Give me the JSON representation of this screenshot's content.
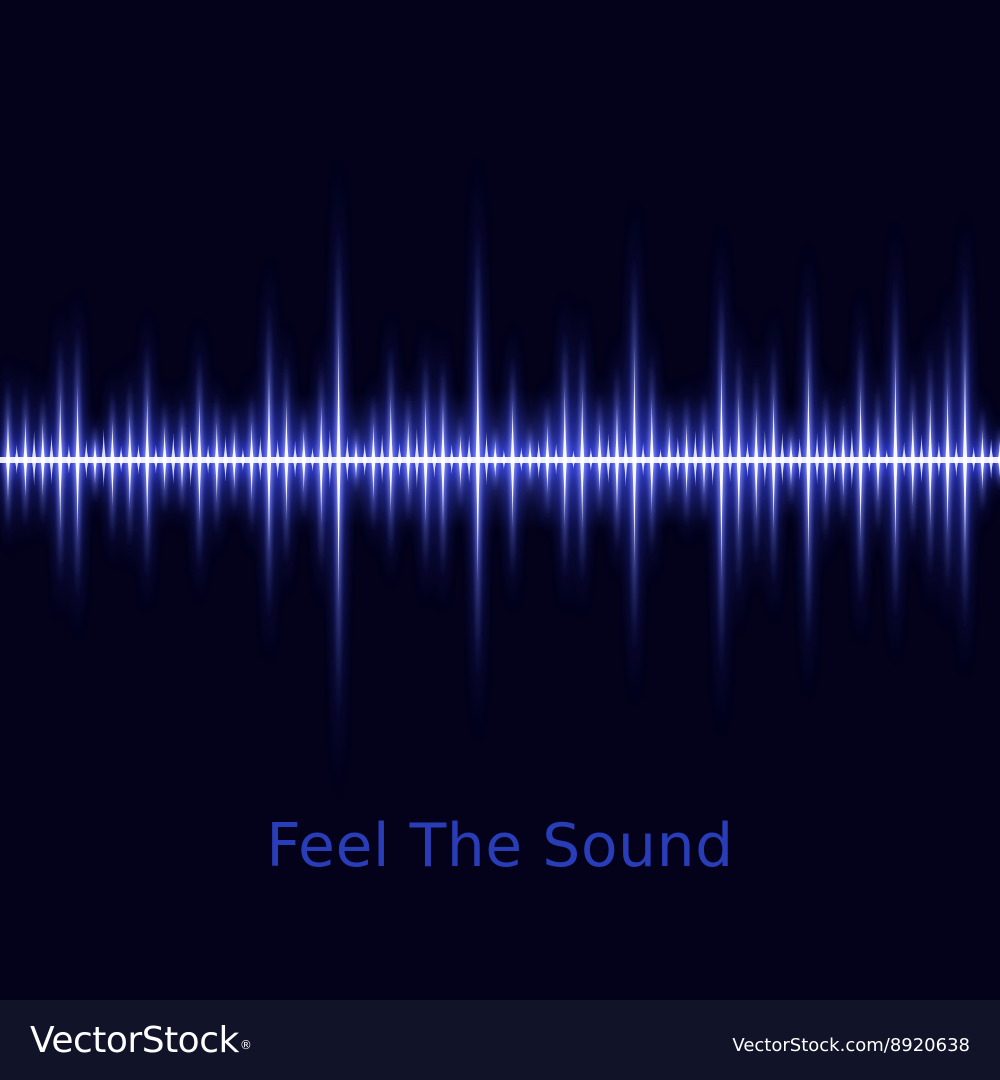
{
  "colors": {
    "background": "#03021a",
    "glow": "#3a4bff",
    "core": "#ffffff",
    "tagline": "#2a3db8",
    "footer_background": "#111329",
    "footer_text": "#ffffff"
  },
  "artwork": {
    "tagline": "Feel The Sound"
  },
  "footer": {
    "brand_name": "VectorStock",
    "brand_mark": "®",
    "image_id": "VectorStock.com/8920638"
  }
}
